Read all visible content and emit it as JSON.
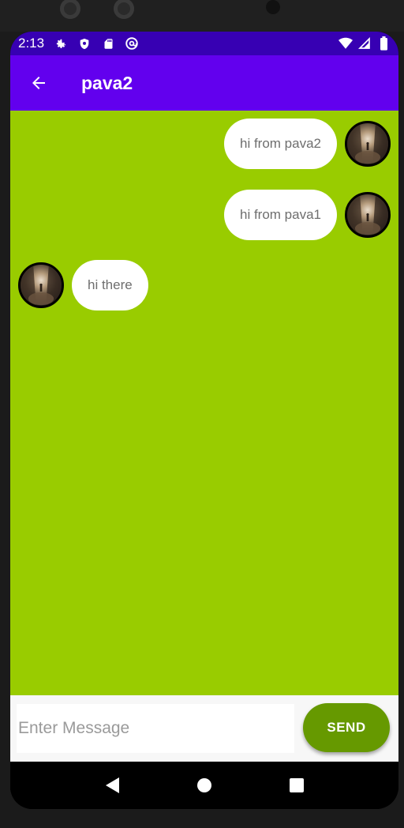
{
  "status_bar": {
    "time": "2:13",
    "left_icons": [
      "gear-icon",
      "shield-icon",
      "sd-card-icon",
      "at-sign-icon"
    ],
    "right_icons": [
      "wifi-icon",
      "cell-signal-icon",
      "battery-icon"
    ],
    "color": "#3700b3"
  },
  "app_bar": {
    "title": "pava2",
    "color": "#6200ee"
  },
  "chat": {
    "background": "#99cc00",
    "messages": [
      {
        "text": "hi from pava2",
        "direction": "outgoing"
      },
      {
        "text": "hi from pava1",
        "direction": "outgoing"
      },
      {
        "text": "hi there",
        "direction": "incoming"
      }
    ]
  },
  "composer": {
    "placeholder": "Enter Message",
    "value": "",
    "send_label": "SEND",
    "send_color": "#669900"
  },
  "nav_bar": {
    "buttons": [
      "back-triangle-icon",
      "home-circle-icon",
      "recents-square-icon"
    ]
  }
}
